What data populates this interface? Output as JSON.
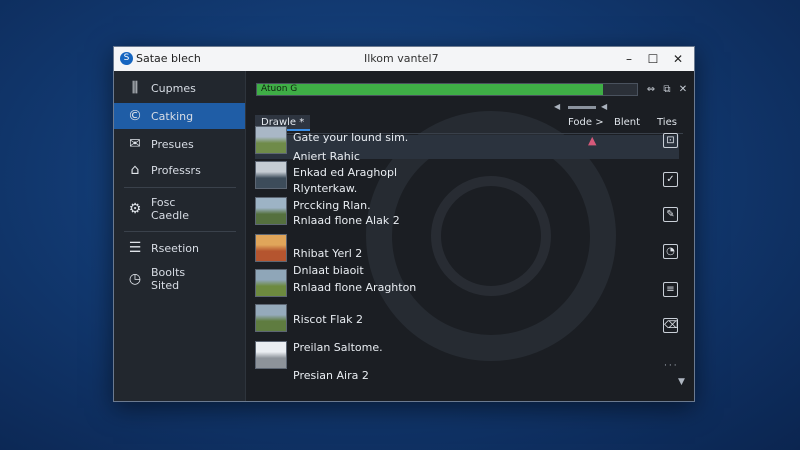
{
  "window": {
    "app_name": "Satae blech",
    "title": "Ilkom vantel7",
    "controls": {
      "minimize": "–",
      "maximize": "☐",
      "close": "✕"
    }
  },
  "sidebar": {
    "items": [
      {
        "label": "Cupmes",
        "icon": "sliders-icon",
        "glyph": "⫼",
        "active": false
      },
      {
        "label": "Catking",
        "icon": "copyright-icon",
        "glyph": "©",
        "active": true
      },
      {
        "label": "Presues",
        "icon": "envelope-icon",
        "glyph": "✉",
        "active": false
      },
      {
        "label": "Professrs",
        "icon": "tag-icon",
        "glyph": "⌂",
        "active": false
      },
      {
        "label_lines": [
          "Fosc",
          "Caedle"
        ],
        "icon": "gear-icon",
        "glyph": "⚙",
        "active": false
      },
      {
        "label": "Rseetion",
        "icon": "stack-icon",
        "glyph": "☰",
        "active": false
      },
      {
        "label_lines": [
          "Boolts",
          "Sited"
        ],
        "icon": "clock-icon",
        "glyph": "◷",
        "active": false
      }
    ]
  },
  "progress": {
    "label": "Atuon G",
    "value_percent": 91,
    "color": "#3fae46"
  },
  "toolbar_icons": [
    {
      "name": "arrows-icon",
      "glyph": "⇔"
    },
    {
      "name": "window-icon",
      "glyph": "⧉"
    },
    {
      "name": "close-small-icon",
      "glyph": "✕"
    }
  ],
  "tab": {
    "label": "Drawle *"
  },
  "columns": {
    "fode": "Fode >",
    "blent": "Blent",
    "ties": "Ties"
  },
  "lines": [
    "Gate your lound sim.",
    "Aniert Rahic",
    "Enkad ed Araghopl",
    "Rlynterkaw.",
    "Prccking Rlan.",
    "Rnlaad flone Alak 2",
    "Rhibat Yerl 2",
    "Dnlaat biaoit",
    "Rnlaad flone Araghton",
    "Riscot Flak 2",
    "Preilan Saltome.",
    "Presian Aira 2"
  ],
  "status_icons": [
    {
      "name": "photo-check-icon",
      "glyph": "⊡"
    },
    {
      "name": "checkbox-icon",
      "glyph": "✓"
    },
    {
      "name": "edit-icon",
      "glyph": "✎"
    },
    {
      "name": "gauge-icon",
      "glyph": "◔"
    },
    {
      "name": "list-icon",
      "glyph": "≡"
    },
    {
      "name": "trash-icon",
      "glyph": "⌫"
    }
  ],
  "thumbnails": [
    {
      "name": "landscape-thumb-1",
      "colors": [
        "#6f8b49",
        "#a9b7c6"
      ]
    },
    {
      "name": "landscape-thumb-2",
      "colors": [
        "#3d4c5a",
        "#c5ccd3"
      ]
    },
    {
      "name": "landscape-thumb-3",
      "colors": [
        "#55703e",
        "#9db3c5"
      ]
    },
    {
      "name": "landscape-thumb-4",
      "colors": [
        "#b5552f",
        "#e0a55a"
      ]
    },
    {
      "name": "landscape-thumb-5",
      "colors": [
        "#6d8a3f",
        "#8fa6b8"
      ]
    },
    {
      "name": "landscape-thumb-6",
      "colors": [
        "#5f7c40",
        "#95aabb"
      ]
    },
    {
      "name": "landscape-thumb-7",
      "colors": [
        "#8d939a",
        "#eaeef2"
      ]
    }
  ]
}
